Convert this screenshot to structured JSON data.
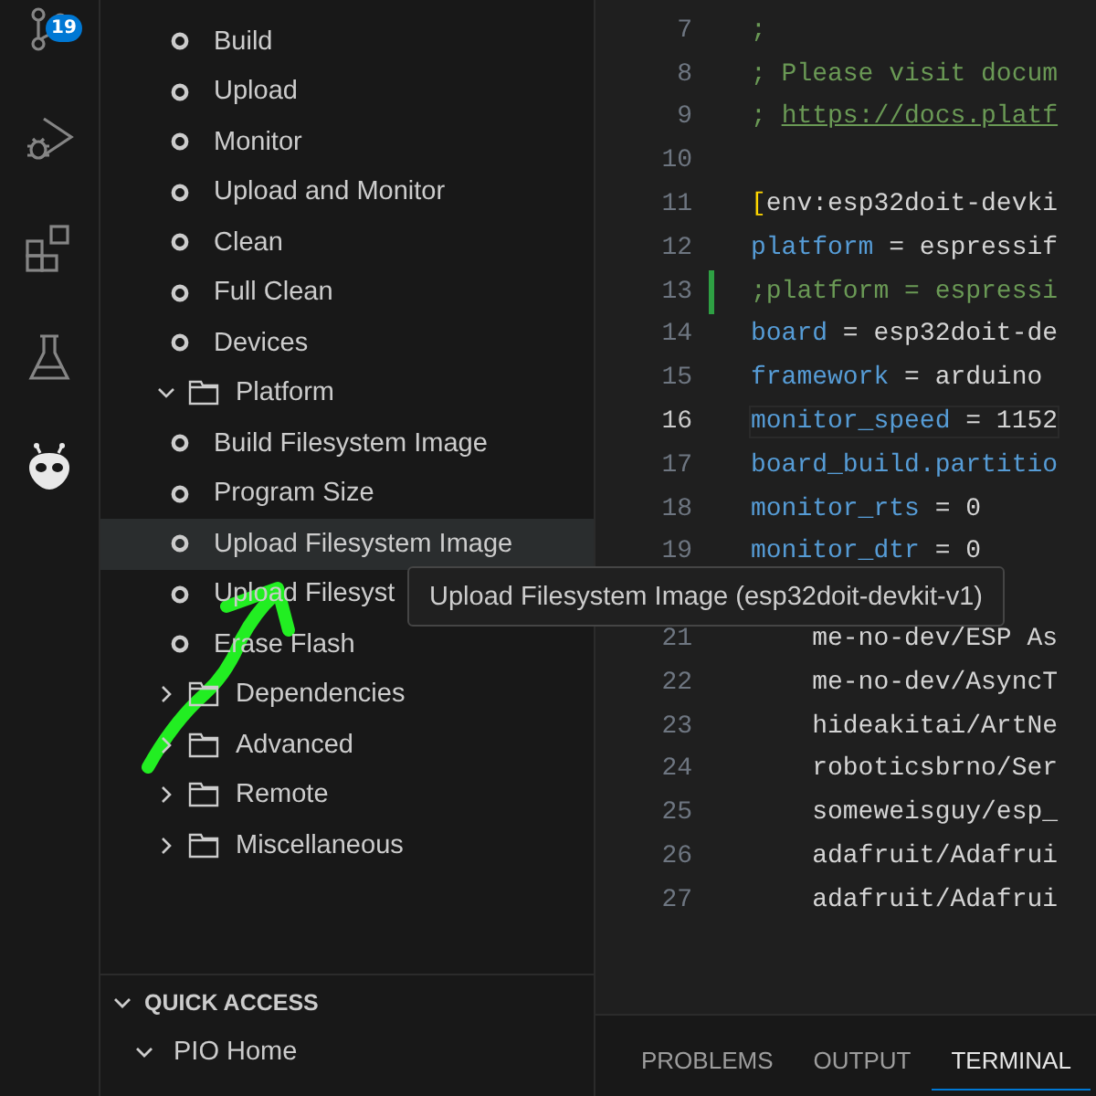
{
  "activity_bar": [
    {
      "kind": "source-control",
      "badge": "19",
      "selected": false
    },
    {
      "kind": "run-debug",
      "selected": false
    },
    {
      "kind": "extensions",
      "selected": false
    },
    {
      "kind": "testing",
      "selected": false
    },
    {
      "kind": "platformio",
      "selected": true
    }
  ],
  "tree": [
    {
      "kind": "task",
      "label": "Build",
      "selected": false
    },
    {
      "kind": "task",
      "label": "Upload",
      "selected": false
    },
    {
      "kind": "task",
      "label": "Monitor",
      "selected": false
    },
    {
      "kind": "task",
      "label": "Upload and Monitor",
      "selected": false
    },
    {
      "kind": "task",
      "label": "Clean",
      "selected": false
    },
    {
      "kind": "task",
      "label": "Full Clean",
      "selected": false
    },
    {
      "kind": "task",
      "label": "Devices",
      "selected": false
    },
    {
      "kind": "folder",
      "label": "Platform",
      "expanded": true,
      "selected": false,
      "children": [
        {
          "kind": "task",
          "label": "Build Filesystem Image",
          "selected": false
        },
        {
          "kind": "task",
          "label": "Program Size",
          "selected": false
        },
        {
          "kind": "task",
          "label": "Upload Filesystem Image",
          "selected": true
        },
        {
          "kind": "task",
          "label": "Upload Filesyst",
          "selected": false
        },
        {
          "kind": "task",
          "label": "Erase Flash",
          "selected": false
        }
      ]
    },
    {
      "kind": "folder",
      "label": "Dependencies",
      "expanded": false,
      "selected": false
    },
    {
      "kind": "folder",
      "label": "Advanced",
      "expanded": false,
      "selected": false
    },
    {
      "kind": "folder",
      "label": "Remote",
      "expanded": false,
      "selected": false
    },
    {
      "kind": "folder",
      "label": "Miscellaneous",
      "expanded": false,
      "selected": false
    }
  ],
  "quick_access": {
    "title": "QUICK ACCESS",
    "expanded": true,
    "items": [
      {
        "label": "PIO Home",
        "expanded": true
      }
    ]
  },
  "editor": {
    "lines": [
      {
        "number": "7",
        "current": false,
        "modified": false,
        "tokens": [
          {
            "kind": "comment",
            "text": ";"
          }
        ]
      },
      {
        "number": "8",
        "current": false,
        "modified": false,
        "tokens": [
          {
            "kind": "comment",
            "text": "; Please visit docum"
          }
        ]
      },
      {
        "number": "9",
        "current": false,
        "modified": false,
        "tokens": [
          {
            "kind": "comment",
            "text": "; "
          },
          {
            "kind": "link",
            "text": "https://docs.platf"
          }
        ]
      },
      {
        "number": "10",
        "current": false,
        "modified": false
      },
      {
        "number": "11",
        "current": false,
        "modified": false,
        "tokens": [
          {
            "kind": "bracket",
            "text": "["
          },
          {
            "kind": "plain",
            "text": "env:esp32doit-devki"
          }
        ]
      },
      {
        "number": "12",
        "current": false,
        "modified": false,
        "tokens": [
          {
            "kind": "key",
            "text": "platform"
          },
          {
            "kind": "plain",
            "text": " = espressif"
          }
        ]
      },
      {
        "number": "13",
        "current": false,
        "modified": true,
        "tokens": [
          {
            "kind": "comment",
            "text": ";platform = espressi"
          }
        ]
      },
      {
        "number": "14",
        "current": false,
        "modified": false,
        "tokens": [
          {
            "kind": "key",
            "text": "board"
          },
          {
            "kind": "plain",
            "text": " = esp32doit-de"
          }
        ]
      },
      {
        "number": "15",
        "current": false,
        "modified": false,
        "tokens": [
          {
            "kind": "key",
            "text": "framework"
          },
          {
            "kind": "plain",
            "text": " = arduino"
          }
        ]
      },
      {
        "number": "16",
        "current": true,
        "modified": false,
        "tokens": [
          {
            "kind": "key",
            "text": "monitor_speed"
          },
          {
            "kind": "plain",
            "text": " = 1152"
          }
        ]
      },
      {
        "number": "17",
        "current": false,
        "modified": false,
        "tokens": [
          {
            "kind": "key",
            "text": "board_build.partitio"
          }
        ]
      },
      {
        "number": "18",
        "current": false,
        "modified": false,
        "tokens": [
          {
            "kind": "key",
            "text": "monitor_rts"
          },
          {
            "kind": "plain",
            "text": " = 0"
          }
        ]
      },
      {
        "number": "19",
        "current": false,
        "modified": false,
        "tokens": [
          {
            "kind": "key",
            "text": "monitor_dtr"
          },
          {
            "kind": "plain",
            "text": " = 0"
          }
        ]
      }
    ],
    "lines_below_tooltip": [
      {
        "number": "21",
        "current": false,
        "modified": false,
        "tokens": [
          {
            "kind": "plain",
            "text": "    me-no-dev/ESP As"
          }
        ]
      },
      {
        "number": "22",
        "current": false,
        "modified": false,
        "tokens": [
          {
            "kind": "plain",
            "text": "    me-no-dev/AsyncT"
          }
        ]
      },
      {
        "number": "23",
        "current": false,
        "modified": false,
        "tokens": [
          {
            "kind": "plain",
            "text": "    hideakitai/ArtNe"
          }
        ]
      },
      {
        "number": "24",
        "current": false,
        "modified": false,
        "tokens": [
          {
            "kind": "plain",
            "text": "    roboticsbrno/Ser"
          }
        ]
      },
      {
        "number": "25",
        "current": false,
        "modified": false,
        "tokens": [
          {
            "kind": "plain",
            "text": "    someweisguy/esp_"
          }
        ]
      },
      {
        "number": "26",
        "current": false,
        "modified": false,
        "tokens": [
          {
            "kind": "plain",
            "text": "    adafruit/Adafrui"
          }
        ]
      },
      {
        "number": "27",
        "current": false,
        "modified": false,
        "tokens": [
          {
            "kind": "plain",
            "text": "    adafruit/Adafrui"
          }
        ]
      }
    ]
  },
  "tooltip": {
    "text": "Upload Filesystem Image (esp32doit-devkit-v1)"
  },
  "panel_tabs": [
    {
      "label": "PROBLEMS",
      "selected": false
    },
    {
      "label": "OUTPUT",
      "selected": false
    },
    {
      "label": "TERMINAL",
      "selected": true
    }
  ]
}
